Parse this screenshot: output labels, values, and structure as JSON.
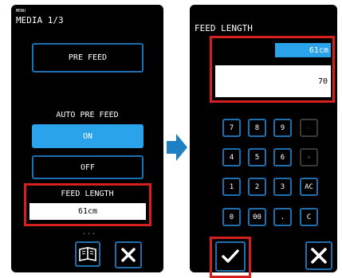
{
  "left_screen": {
    "menu_label": "MENU",
    "title": "MEDIA 1/3",
    "pre_feed_label": "PRE FEED",
    "auto_pre_feed_label": "AUTO PRE FEED",
    "on_label": "ON",
    "off_label": "OFF",
    "feed_length_label": "FEED LENGTH",
    "feed_length_value": "61cm",
    "page_dots": "• • •",
    "book_icon": "book-icon",
    "close_icon": "close-icon"
  },
  "right_screen": {
    "title": "FEED LENGTH",
    "current_value": "61cm",
    "input_value": "70",
    "keypad": [
      [
        "7",
        "8",
        "9",
        "-"
      ],
      [
        "4",
        "5",
        "6",
        "+"
      ],
      [
        "1",
        "2",
        "3",
        "AC"
      ],
      [
        "0",
        "00",
        ".",
        "C"
      ]
    ],
    "disabled_keys": [
      "-",
      "+"
    ],
    "confirm_icon": "check-icon",
    "close_icon": "close-icon"
  },
  "colors": {
    "accent_blue": "#2ba3ea",
    "button_border": "#1d6fb0",
    "highlight_red": "#d62020",
    "arrow_blue": "#1f7fc4"
  },
  "arrow_icon": "right-arrow-icon"
}
